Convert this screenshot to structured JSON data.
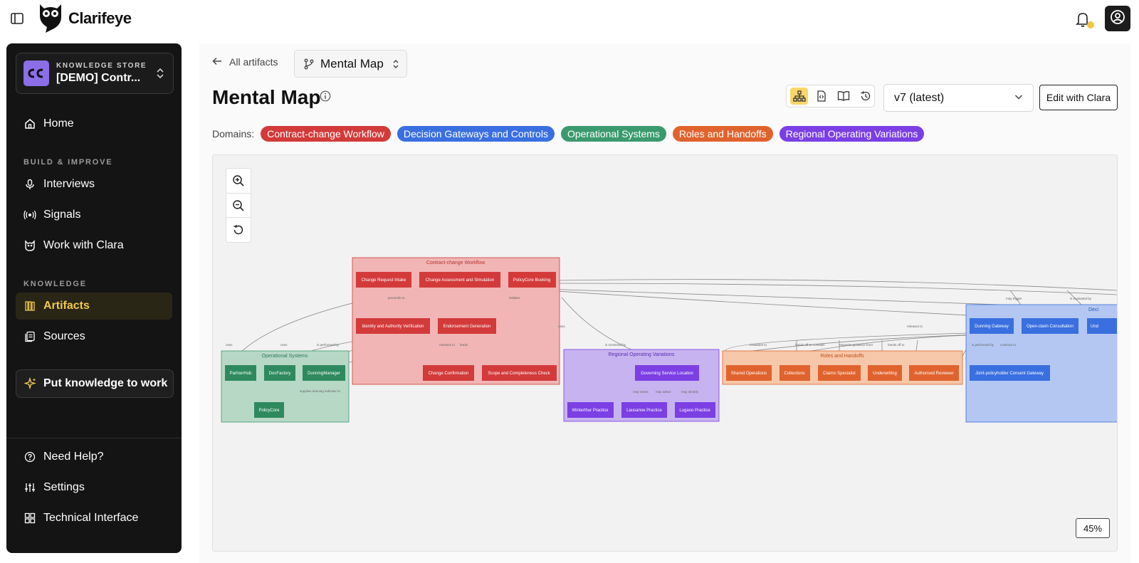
{
  "app": {
    "name": "Clarifeye"
  },
  "sidebar": {
    "store_caption": "KNOWLEDGE STORE",
    "store_name": "[DEMO] Contr...",
    "home": "Home",
    "section_build": "BUILD & IMPROVE",
    "interviews": "Interviews",
    "signals": "Signals",
    "work_with_clara": "Work with Clara",
    "section_knowledge": "KNOWLEDGE",
    "artifacts": "Artifacts",
    "sources": "Sources",
    "cta": "Put knowledge to work",
    "need_help": "Need Help?",
    "settings": "Settings",
    "technical": "Technical Interface"
  },
  "header": {
    "back_label": "All artifacts",
    "artifact_selected": "Mental Map",
    "title": "Mental Map",
    "version": "v7 (latest)",
    "edit_label": "Edit with Clara",
    "domains_label": "Domains:"
  },
  "colors": {
    "red": "#d33a3a",
    "blue": "#3a6fe0",
    "green": "#3a9a6e",
    "orange": "#e0632e",
    "purple": "#7b3fe4",
    "accent_yellow": "#f0c94a"
  },
  "domains": [
    {
      "label": "Contract-change Workflow",
      "color": "#d33a3a"
    },
    {
      "label": "Decision Gateways and Controls",
      "color": "#3a6fe0"
    },
    {
      "label": "Operational Systems",
      "color": "#3a9a6e"
    },
    {
      "label": "Roles and Handoffs",
      "color": "#e0632e"
    },
    {
      "label": "Regional Operating Variations",
      "color": "#7b3fe4"
    }
  ],
  "map": {
    "zoom": "45%",
    "groups": {
      "contract": "Contract-change Workflow",
      "operational": "Operational Systems",
      "regional": "Regional Operating Variations",
      "roles": "Roles and Handoffs",
      "decision": "Deci"
    },
    "nodes": {
      "change_request_intake": "Change Request Intake",
      "change_assessment": "Change Assessment and Simulation",
      "policycore_booking": "PolicyCore Booking",
      "identity_verification": "Identity and Authority Verification",
      "endorsement_generation": "Endorsement Generation",
      "change_confirmation": "Change Confirmation",
      "scope_check": "Scope and Completeness Check",
      "partnerhub": "PartnerHub",
      "docfactory": "DocFactory",
      "dunningmanager": "DunningManager",
      "policycore": "PolicyCore",
      "governing_location": "Governing Service Location",
      "winterthur": "Winterthur Practice",
      "lausanne": "Lausanne Practice",
      "lugano": "Lugano Practice",
      "shared_operations": "Shared Operations",
      "collections": "Collections",
      "claims_specialist": "Claims Specialist",
      "underwriting": "Underwriting",
      "authorised_reviewer": "Authorised Reviewer",
      "dunning_gateway": "Dunning Gateway",
      "open_claim": "Open-claim Consultation",
      "und_cut": "Und",
      "joint_consent": "Joint-policyholder Consent Gateway"
    },
    "edges": {
      "proceeds_to": "proceeds to",
      "initiates": "initiates",
      "releases_to_1": "releases to",
      "feeds": "feeds",
      "uses_1": "uses",
      "uses_2": "uses",
      "uses_3": "uses",
      "performed_by_1": "is performed by",
      "supplies_dunning": "supplies dunning indicator to",
      "may_select_1": "may select",
      "may_select_2": "may select",
      "may_identify": "may identify",
      "screened_by": "is screened by",
      "escalates_to": "escalates to",
      "hands_off": "hands off or consults",
      "requests_guidance": "requests guidance from",
      "hands_off_to": "hands off to",
      "releases_to_2": "releases to",
      "performed_by_2": "is performed by",
      "continue_to": "continue to",
      "may_trigger": "may trigger",
      "evaluated_by": "is evaluated by"
    }
  }
}
